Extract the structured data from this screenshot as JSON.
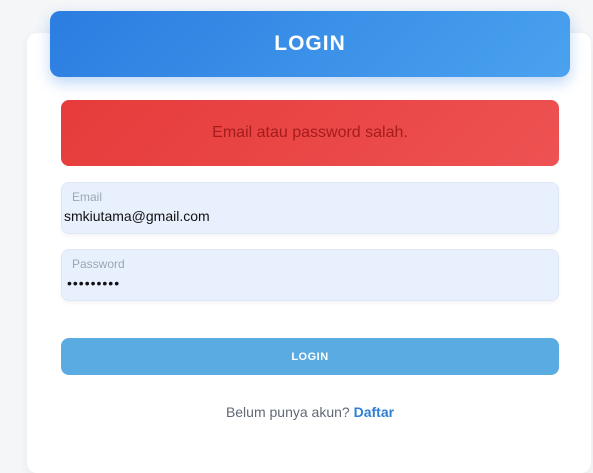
{
  "header": {
    "title": "LOGIN"
  },
  "alert": {
    "message": "Email atau password salah."
  },
  "form": {
    "email": {
      "label": "Email",
      "value": "smkiutama@gmail.com"
    },
    "password": {
      "label": "Password",
      "value": "•••••••••"
    },
    "submit_label": "LOGIN"
  },
  "signup": {
    "prompt": "Belum punya akun?",
    "link_label": "Daftar"
  }
}
